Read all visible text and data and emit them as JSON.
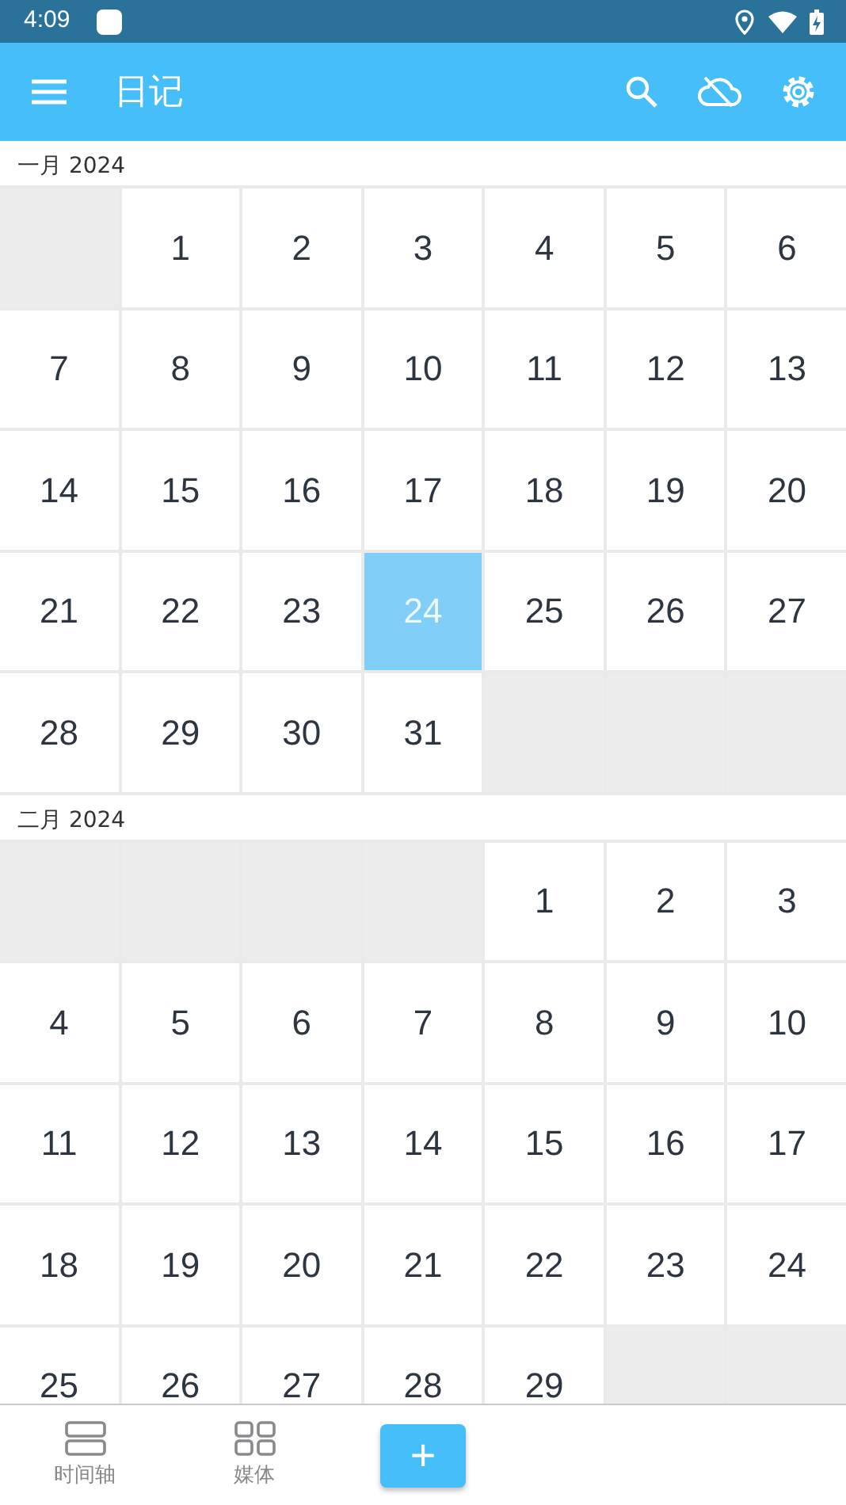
{
  "status_bar": {
    "time": "4:09"
  },
  "app_bar": {
    "title": "日记"
  },
  "months": [
    {
      "label": "一月 2024",
      "cells": [
        {
          "kind": "blank"
        },
        {
          "kind": "day",
          "day": "1",
          "selected": false
        },
        {
          "kind": "day",
          "day": "2",
          "selected": false
        },
        {
          "kind": "day",
          "day": "3",
          "selected": false
        },
        {
          "kind": "day",
          "day": "4",
          "selected": false
        },
        {
          "kind": "day",
          "day": "5",
          "selected": false
        },
        {
          "kind": "day",
          "day": "6",
          "selected": false
        },
        {
          "kind": "day",
          "day": "7",
          "selected": false
        },
        {
          "kind": "day",
          "day": "8",
          "selected": false
        },
        {
          "kind": "day",
          "day": "9",
          "selected": false
        },
        {
          "kind": "day",
          "day": "10",
          "selected": false
        },
        {
          "kind": "day",
          "day": "11",
          "selected": false
        },
        {
          "kind": "day",
          "day": "12",
          "selected": false
        },
        {
          "kind": "day",
          "day": "13",
          "selected": false
        },
        {
          "kind": "day",
          "day": "14",
          "selected": false
        },
        {
          "kind": "day",
          "day": "15",
          "selected": false
        },
        {
          "kind": "day",
          "day": "16",
          "selected": false
        },
        {
          "kind": "day",
          "day": "17",
          "selected": false
        },
        {
          "kind": "day",
          "day": "18",
          "selected": false
        },
        {
          "kind": "day",
          "day": "19",
          "selected": false
        },
        {
          "kind": "day",
          "day": "20",
          "selected": false
        },
        {
          "kind": "day",
          "day": "21",
          "selected": false
        },
        {
          "kind": "day",
          "day": "22",
          "selected": false
        },
        {
          "kind": "day",
          "day": "23",
          "selected": false
        },
        {
          "kind": "day",
          "day": "24",
          "selected": true
        },
        {
          "kind": "day",
          "day": "25",
          "selected": false
        },
        {
          "kind": "day",
          "day": "26",
          "selected": false
        },
        {
          "kind": "day",
          "day": "27",
          "selected": false
        },
        {
          "kind": "day",
          "day": "28",
          "selected": false
        },
        {
          "kind": "day",
          "day": "29",
          "selected": false
        },
        {
          "kind": "day",
          "day": "30",
          "selected": false
        },
        {
          "kind": "day",
          "day": "31",
          "selected": false
        },
        {
          "kind": "blank"
        },
        {
          "kind": "blank"
        },
        {
          "kind": "blank"
        }
      ]
    },
    {
      "label": "二月 2024",
      "cells": [
        {
          "kind": "blank"
        },
        {
          "kind": "blank"
        },
        {
          "kind": "blank"
        },
        {
          "kind": "blank"
        },
        {
          "kind": "day",
          "day": "1",
          "selected": false
        },
        {
          "kind": "day",
          "day": "2",
          "selected": false
        },
        {
          "kind": "day",
          "day": "3",
          "selected": false
        },
        {
          "kind": "day",
          "day": "4",
          "selected": false
        },
        {
          "kind": "day",
          "day": "5",
          "selected": false
        },
        {
          "kind": "day",
          "day": "6",
          "selected": false
        },
        {
          "kind": "day",
          "day": "7",
          "selected": false
        },
        {
          "kind": "day",
          "day": "8",
          "selected": false
        },
        {
          "kind": "day",
          "day": "9",
          "selected": false
        },
        {
          "kind": "day",
          "day": "10",
          "selected": false
        },
        {
          "kind": "day",
          "day": "11",
          "selected": false
        },
        {
          "kind": "day",
          "day": "12",
          "selected": false
        },
        {
          "kind": "day",
          "day": "13",
          "selected": false
        },
        {
          "kind": "day",
          "day": "14",
          "selected": false
        },
        {
          "kind": "day",
          "day": "15",
          "selected": false
        },
        {
          "kind": "day",
          "day": "16",
          "selected": false
        },
        {
          "kind": "day",
          "day": "17",
          "selected": false
        },
        {
          "kind": "day",
          "day": "18",
          "selected": false
        },
        {
          "kind": "day",
          "day": "19",
          "selected": false
        },
        {
          "kind": "day",
          "day": "20",
          "selected": false
        },
        {
          "kind": "day",
          "day": "21",
          "selected": false
        },
        {
          "kind": "day",
          "day": "22",
          "selected": false
        },
        {
          "kind": "day",
          "day": "23",
          "selected": false
        },
        {
          "kind": "day",
          "day": "24",
          "selected": false
        },
        {
          "kind": "day",
          "day": "25",
          "selected": false
        },
        {
          "kind": "day",
          "day": "26",
          "selected": false
        },
        {
          "kind": "day",
          "day": "27",
          "selected": false
        },
        {
          "kind": "day",
          "day": "28",
          "selected": false
        },
        {
          "kind": "day",
          "day": "29",
          "selected": false
        },
        {
          "kind": "blank"
        },
        {
          "kind": "blank"
        }
      ]
    }
  ],
  "bottom_nav": [
    {
      "kind": "timeline",
      "label": "时间轴"
    },
    {
      "kind": "media",
      "label": "媒体"
    },
    {
      "kind": "add",
      "label": "+"
    }
  ]
}
